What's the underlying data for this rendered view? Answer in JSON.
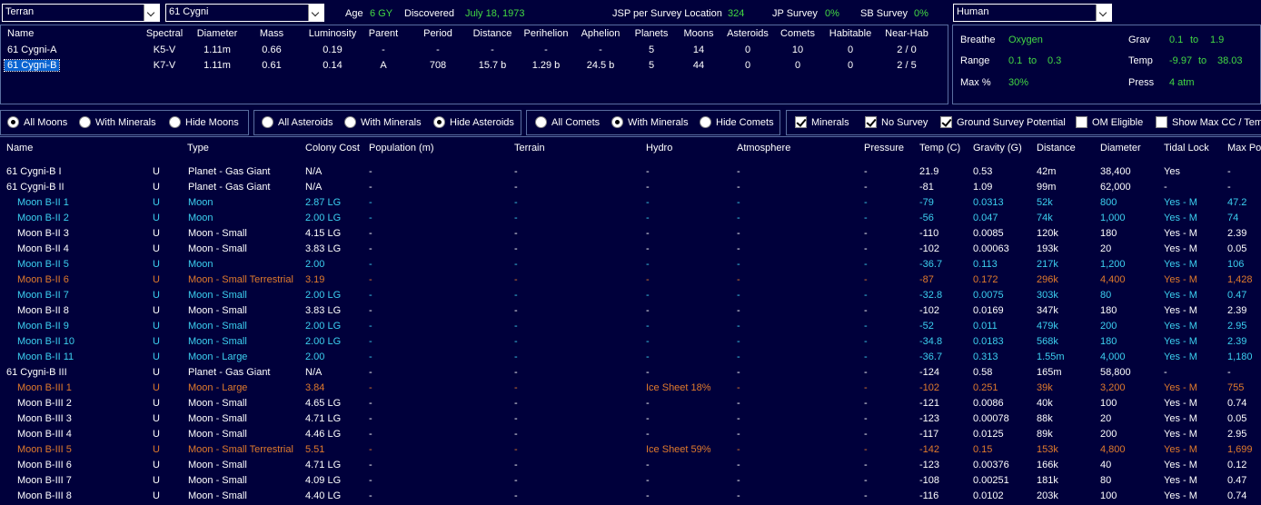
{
  "top": {
    "race_select": "Terran",
    "system_select": "61 Cygni",
    "age_label": "Age",
    "age_value": "6 GY",
    "discovered_label": "Discovered",
    "discovered_value": "July 18, 1973",
    "jsp_label": "JSP per Survey Location",
    "jsp_value": "324",
    "jp_label": "JP Survey",
    "jp_value": "0%",
    "sb_label": "SB Survey",
    "sb_value": "0%",
    "species_select": "Human"
  },
  "stars": {
    "headers": [
      "Name",
      "Spectral",
      "Diameter",
      "Mass",
      "Luminosity",
      "Parent",
      "Period",
      "Distance",
      "Perihelion",
      "Aphelion",
      "Planets",
      "Moons",
      "Asteroids",
      "Comets",
      "Habitable",
      "Near-Hab"
    ],
    "rows": [
      [
        "61 Cygni-A",
        "K5-V",
        "1.11m",
        "0.66",
        "0.19",
        "-",
        "-",
        "-",
        "-",
        "-",
        "5",
        "14",
        "0",
        "10",
        "0",
        "2 / 0"
      ],
      [
        "61 Cygni-B",
        "K7-V",
        "1.11m",
        "0.61",
        "0.14",
        "A",
        "708",
        "15.7 b",
        "1.29 b",
        "24.5 b",
        "5",
        "44",
        "0",
        "0",
        "0",
        "2 / 5"
      ]
    ],
    "selected_index": 1
  },
  "environment": {
    "breathe_label": "Breathe",
    "breathe_value": "Oxygen",
    "range_label": "Range",
    "range_min": "0.1",
    "range_to": "to",
    "range_max": "0.3",
    "maxpct_label": "Max %",
    "maxpct_value": "30%",
    "grav_label": "Grav",
    "grav_min": "0.1",
    "grav_to": "to",
    "grav_max": "1.9",
    "temp_label": "Temp",
    "temp_min": "-9.97",
    "temp_to": "to",
    "temp_max": "38.03",
    "press_label": "Press",
    "press_value": "4 atm"
  },
  "filters": {
    "moons": [
      {
        "label": "All Moons",
        "on": true
      },
      {
        "label": "With Minerals",
        "on": false
      },
      {
        "label": "Hide Moons",
        "on": false
      }
    ],
    "asteroids": [
      {
        "label": "All Asteroids",
        "on": false
      },
      {
        "label": "With Minerals",
        "on": false
      },
      {
        "label": "Hide Asteroids",
        "on": true
      }
    ],
    "comets": [
      {
        "label": "All Comets",
        "on": false
      },
      {
        "label": "With Minerals",
        "on": true
      },
      {
        "label": "Hide Comets",
        "on": false
      }
    ],
    "checks": [
      {
        "label": "Minerals",
        "on": true
      },
      {
        "label": "No Survey",
        "on": true
      },
      {
        "label": "Ground Survey Potential",
        "on": true
      },
      {
        "label": "OM Eligible",
        "on": false
      },
      {
        "label": "Show Max CC / Temp",
        "on": false
      }
    ]
  },
  "colors": {
    "background": "#00003b",
    "green": "#43d943",
    "cyan": "#3cd0f0",
    "orange": "#e07a2c",
    "border": "#5a6ea0"
  },
  "bodies": {
    "headers": [
      "Name",
      "Type",
      "Colony Cost",
      "Population (m)",
      "Terrain",
      "Hydro",
      "Atmosphere",
      "Pressure",
      "Temp (C)",
      "Gravity (G)",
      "Distance",
      "Diameter",
      "Tidal Lock",
      "Max Pop"
    ],
    "rows": [
      {
        "c": "white",
        "name": "61 Cygni-B I",
        "u": "U",
        "type": "Planet - Gas Giant",
        "cc": "N/A",
        "pop": "-",
        "terrain": "-",
        "hydro": "-",
        "atm": "-",
        "press": "-",
        "temp": "21.9",
        "grav": "0.53",
        "dist": "42m",
        "diam": "38,400",
        "tidal": "Yes",
        "maxpop": "-",
        "indent": false
      },
      {
        "c": "white",
        "name": "61 Cygni-B II",
        "u": "U",
        "type": "Planet - Gas Giant",
        "cc": "N/A",
        "pop": "-",
        "terrain": "-",
        "hydro": "-",
        "atm": "-",
        "press": "-",
        "temp": "-81",
        "grav": "1.09",
        "dist": "99m",
        "diam": "62,000",
        "tidal": "-",
        "maxpop": "-",
        "indent": false
      },
      {
        "c": "cyan",
        "name": "Moon B-II 1",
        "u": "U",
        "type": "Moon",
        "cc": "2.87 LG",
        "pop": "-",
        "terrain": "-",
        "hydro": "-",
        "atm": "-",
        "press": "-",
        "temp": "-79",
        "grav": "0.0313",
        "dist": "52k",
        "diam": "800",
        "tidal": "Yes - M",
        "maxpop": "47.2",
        "indent": true
      },
      {
        "c": "cyan",
        "name": "Moon B-II 2",
        "u": "U",
        "type": "Moon",
        "cc": "2.00 LG",
        "pop": "-",
        "terrain": "-",
        "hydro": "-",
        "atm": "-",
        "press": "-",
        "temp": "-56",
        "grav": "0.047",
        "dist": "74k",
        "diam": "1,000",
        "tidal": "Yes - M",
        "maxpop": "74",
        "indent": true
      },
      {
        "c": "white",
        "name": "Moon B-II 3",
        "u": "U",
        "type": "Moon - Small",
        "cc": "4.15 LG",
        "pop": "-",
        "terrain": "-",
        "hydro": "-",
        "atm": "-",
        "press": "-",
        "temp": "-110",
        "grav": "0.0085",
        "dist": "120k",
        "diam": "180",
        "tidal": "Yes - M",
        "maxpop": "2.39",
        "indent": true
      },
      {
        "c": "white",
        "name": "Moon B-II 4",
        "u": "U",
        "type": "Moon - Small",
        "cc": "3.83 LG",
        "pop": "-",
        "terrain": "-",
        "hydro": "-",
        "atm": "-",
        "press": "-",
        "temp": "-102",
        "grav": "0.00063",
        "dist": "193k",
        "diam": "20",
        "tidal": "Yes - M",
        "maxpop": "0.05",
        "indent": true
      },
      {
        "c": "cyan",
        "name": "Moon B-II 5",
        "u": "U",
        "type": "Moon",
        "cc": "2.00",
        "pop": "-",
        "terrain": "-",
        "hydro": "-",
        "atm": "-",
        "press": "-",
        "temp": "-36.7",
        "grav": "0.113",
        "dist": "217k",
        "diam": "1,200",
        "tidal": "Yes - M",
        "maxpop": "106",
        "indent": true
      },
      {
        "c": "orange",
        "name": "Moon B-II 6",
        "u": "U",
        "type": "Moon - Small Terrestrial",
        "cc": "3.19",
        "pop": "-",
        "terrain": "-",
        "hydro": "-",
        "atm": "-",
        "press": "-",
        "temp": "-87",
        "grav": "0.172",
        "dist": "296k",
        "diam": "4,400",
        "tidal": "Yes - M",
        "maxpop": "1,428",
        "indent": true
      },
      {
        "c": "cyan",
        "name": "Moon B-II 7",
        "u": "U",
        "type": "Moon - Small",
        "cc": "2.00 LG",
        "pop": "-",
        "terrain": "-",
        "hydro": "-",
        "atm": "-",
        "press": "-",
        "temp": "-32.8",
        "grav": "0.0075",
        "dist": "303k",
        "diam": "80",
        "tidal": "Yes - M",
        "maxpop": "0.47",
        "indent": true
      },
      {
        "c": "white",
        "name": "Moon B-II 8",
        "u": "U",
        "type": "Moon - Small",
        "cc": "3.83 LG",
        "pop": "-",
        "terrain": "-",
        "hydro": "-",
        "atm": "-",
        "press": "-",
        "temp": "-102",
        "grav": "0.0169",
        "dist": "347k",
        "diam": "180",
        "tidal": "Yes - M",
        "maxpop": "2.39",
        "indent": true
      },
      {
        "c": "cyan",
        "name": "Moon B-II 9",
        "u": "U",
        "type": "Moon - Small",
        "cc": "2.00 LG",
        "pop": "-",
        "terrain": "-",
        "hydro": "-",
        "atm": "-",
        "press": "-",
        "temp": "-52",
        "grav": "0.011",
        "dist": "479k",
        "diam": "200",
        "tidal": "Yes - M",
        "maxpop": "2.95",
        "indent": true
      },
      {
        "c": "cyan",
        "name": "Moon B-II 10",
        "u": "U",
        "type": "Moon - Small",
        "cc": "2.00 LG",
        "pop": "-",
        "terrain": "-",
        "hydro": "-",
        "atm": "-",
        "press": "-",
        "temp": "-34.8",
        "grav": "0.0183",
        "dist": "568k",
        "diam": "180",
        "tidal": "Yes - M",
        "maxpop": "2.39",
        "indent": true
      },
      {
        "c": "cyan",
        "name": "Moon B-II 11",
        "u": "U",
        "type": "Moon - Large",
        "cc": "2.00",
        "pop": "-",
        "terrain": "-",
        "hydro": "-",
        "atm": "-",
        "press": "-",
        "temp": "-36.7",
        "grav": "0.313",
        "dist": "1.55m",
        "diam": "4,000",
        "tidal": "Yes - M",
        "maxpop": "1,180",
        "indent": true
      },
      {
        "c": "white",
        "name": "61 Cygni-B III",
        "u": "U",
        "type": "Planet - Gas Giant",
        "cc": "N/A",
        "pop": "-",
        "terrain": "-",
        "hydro": "-",
        "atm": "-",
        "press": "-",
        "temp": "-124",
        "grav": "0.58",
        "dist": "165m",
        "diam": "58,800",
        "tidal": "-",
        "maxpop": "-",
        "indent": false
      },
      {
        "c": "orange",
        "name": "Moon B-III 1",
        "u": "U",
        "type": "Moon - Large",
        "cc": "3.84",
        "pop": "-",
        "terrain": "-",
        "hydro": "Ice Sheet 18%",
        "atm": "-",
        "press": "-",
        "temp": "-102",
        "grav": "0.251",
        "dist": "39k",
        "diam": "3,200",
        "tidal": "Yes - M",
        "maxpop": "755",
        "indent": true
      },
      {
        "c": "white",
        "name": "Moon B-III 2",
        "u": "U",
        "type": "Moon - Small",
        "cc": "4.65 LG",
        "pop": "-",
        "terrain": "-",
        "hydro": "-",
        "atm": "-",
        "press": "-",
        "temp": "-121",
        "grav": "0.0086",
        "dist": "40k",
        "diam": "100",
        "tidal": "Yes - M",
        "maxpop": "0.74",
        "indent": true
      },
      {
        "c": "white",
        "name": "Moon B-III 3",
        "u": "U",
        "type": "Moon - Small",
        "cc": "4.71 LG",
        "pop": "-",
        "terrain": "-",
        "hydro": "-",
        "atm": "-",
        "press": "-",
        "temp": "-123",
        "grav": "0.00078",
        "dist": "88k",
        "diam": "20",
        "tidal": "Yes - M",
        "maxpop": "0.05",
        "indent": true
      },
      {
        "c": "white",
        "name": "Moon B-III 4",
        "u": "U",
        "type": "Moon - Small",
        "cc": "4.46 LG",
        "pop": "-",
        "terrain": "-",
        "hydro": "-",
        "atm": "-",
        "press": "-",
        "temp": "-117",
        "grav": "0.0125",
        "dist": "89k",
        "diam": "200",
        "tidal": "Yes - M",
        "maxpop": "2.95",
        "indent": true
      },
      {
        "c": "orange",
        "name": "Moon B-III 5",
        "u": "U",
        "type": "Moon - Small Terrestrial",
        "cc": "5.51",
        "pop": "-",
        "terrain": "-",
        "hydro": "Ice Sheet 59%",
        "atm": "-",
        "press": "-",
        "temp": "-142",
        "grav": "0.15",
        "dist": "153k",
        "diam": "4,800",
        "tidal": "Yes - M",
        "maxpop": "1,699",
        "indent": true
      },
      {
        "c": "white",
        "name": "Moon B-III 6",
        "u": "U",
        "type": "Moon - Small",
        "cc": "4.71 LG",
        "pop": "-",
        "terrain": "-",
        "hydro": "-",
        "atm": "-",
        "press": "-",
        "temp": "-123",
        "grav": "0.00376",
        "dist": "166k",
        "diam": "40",
        "tidal": "Yes - M",
        "maxpop": "0.12",
        "indent": true
      },
      {
        "c": "white",
        "name": "Moon B-III 7",
        "u": "U",
        "type": "Moon - Small",
        "cc": "4.09 LG",
        "pop": "-",
        "terrain": "-",
        "hydro": "-",
        "atm": "-",
        "press": "-",
        "temp": "-108",
        "grav": "0.00251",
        "dist": "181k",
        "diam": "80",
        "tidal": "Yes - M",
        "maxpop": "0.47",
        "indent": true
      },
      {
        "c": "white",
        "name": "Moon B-III 8",
        "u": "U",
        "type": "Moon - Small",
        "cc": "4.40 LG",
        "pop": "-",
        "terrain": "-",
        "hydro": "-",
        "atm": "-",
        "press": "-",
        "temp": "-116",
        "grav": "0.0102",
        "dist": "203k",
        "diam": "100",
        "tidal": "Yes - M",
        "maxpop": "0.74",
        "indent": true
      }
    ]
  }
}
